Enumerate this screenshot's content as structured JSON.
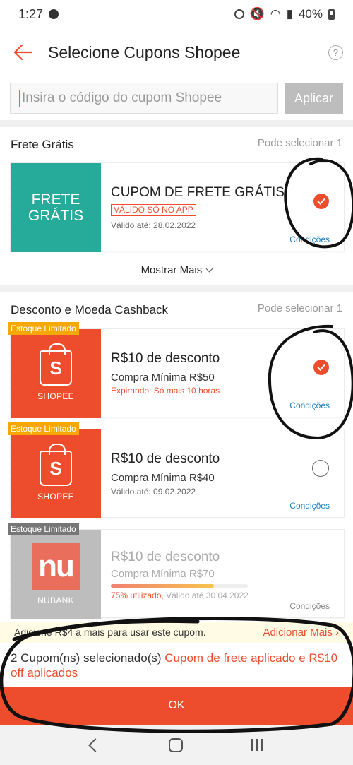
{
  "status_bar": {
    "time": "1:27",
    "battery": "40%"
  },
  "header": {
    "title": "Selecione Cupons Shopee",
    "help_glyph": "?"
  },
  "search": {
    "placeholder": "Insira o código do cupom Shopee",
    "apply_label": "Aplicar"
  },
  "free_shipping": {
    "title": "Frete Grátis",
    "hint": "Pode selecionar 1",
    "coupon": {
      "stub_text": "FRETE GRÁTIS",
      "title": "CUPOM DE FRETE GRÁTIS",
      "tag": "VÁLIDO SÓ NO APP",
      "validity": "Válido até: 28.02.2022",
      "conditions": "Condições",
      "selected": true
    },
    "show_more": "Mostrar Mais"
  },
  "discount": {
    "title": "Desconto e Moeda Cashback",
    "hint": "Pode selecionar 1",
    "coupons": [
      {
        "badge": "Estoque Limitado",
        "brand": "SHOPEE",
        "bag_letter": "S",
        "title": "R$10 de desconto",
        "min": "Compra Mínima R$50",
        "meta": "Expirando: Só mais 10 horas",
        "conditions": "Condições",
        "selected": true
      },
      {
        "badge": "Estoque Limitado",
        "brand": "SHOPEE",
        "bag_letter": "S",
        "title": "R$10 de desconto",
        "min": "Compra Mínima R$40",
        "meta": "Válido até: 09.02.2022",
        "conditions": "Condições",
        "selected": false
      },
      {
        "badge": "Estoque Limitado",
        "brand": "NUBANK",
        "logo_text": "nu",
        "title": "R$10 de desconto",
        "min": "Compra Mínima R$70",
        "usage": "75% utilizado,",
        "meta": "Válido até 30.04.2022",
        "usage_fraction": 0.75,
        "conditions": "Condições",
        "selected": false,
        "disabled": true
      }
    ]
  },
  "add_more_bar": {
    "text": "Adicione R$4 a mais para usar este cupom.",
    "action": "Adicionar Mais"
  },
  "footer": {
    "count_text": "2 Cupom(ns) selecionado(s)",
    "applied_text": "Cupom de frete aplicado e R$10 off aplicados",
    "ok_label": "OK"
  },
  "colors": {
    "accent": "#ee4d2d",
    "teal": "#26aa99",
    "link": "#1b7ec2",
    "badge": "#f6a700"
  }
}
